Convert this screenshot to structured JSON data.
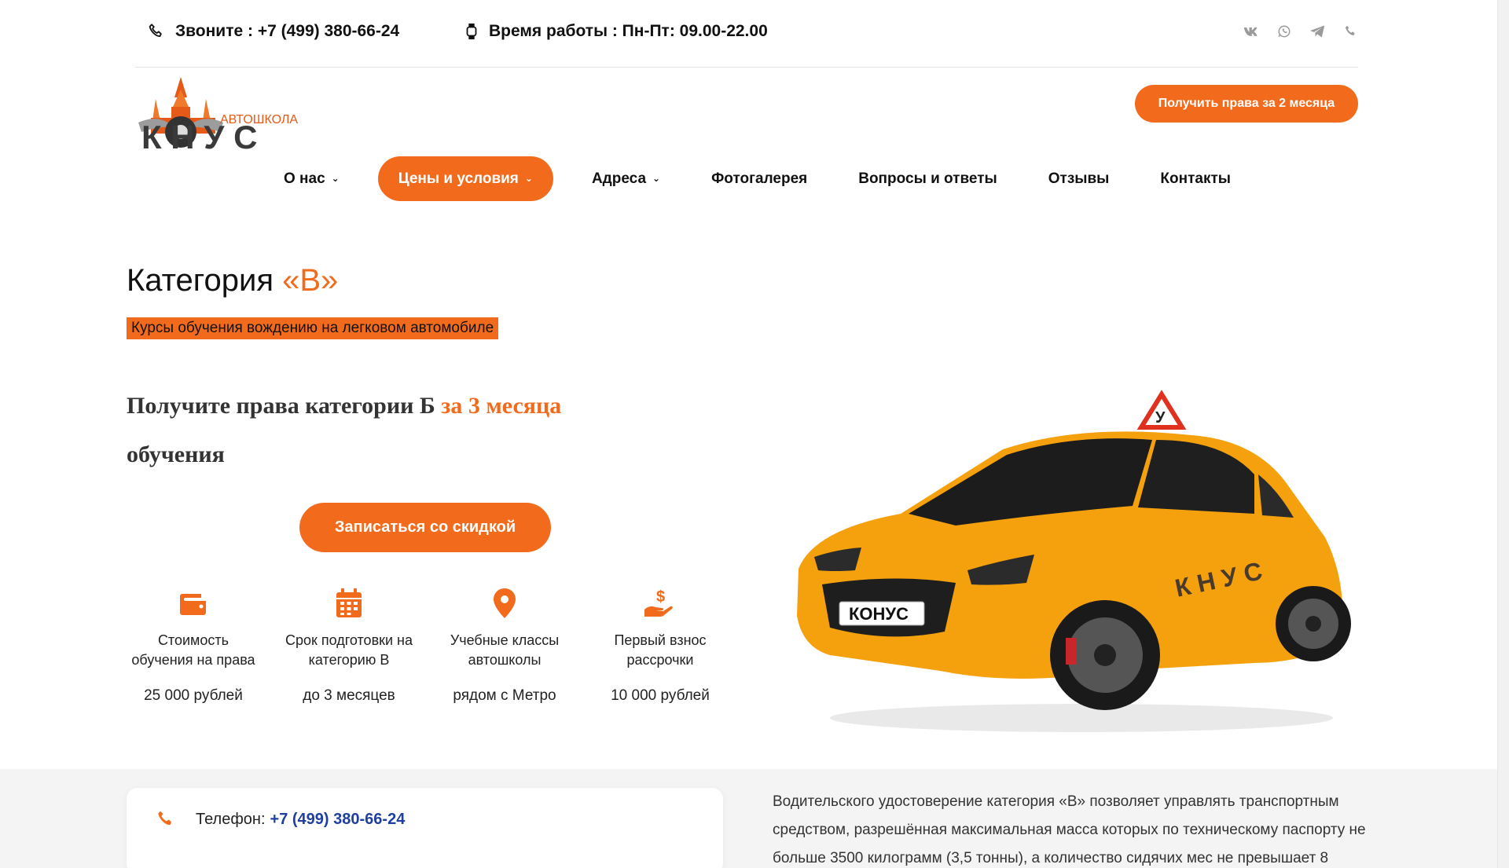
{
  "topbar": {
    "phone": "Звоните : +7 (499) 380-66-24",
    "hours": "Время работы : Пн-Пт: 09.00-22.00",
    "socials": [
      "vk-icon",
      "whatsapp-icon",
      "telegram-icon",
      "phone-icon"
    ]
  },
  "logo": {
    "top": "АВТОШКОЛА",
    "main": "К  Н У С"
  },
  "header": {
    "cta": "Получить права за 2 месяца"
  },
  "nav": {
    "items": [
      {
        "label": "О нас",
        "dropdown": true
      },
      {
        "label": "Цены и условия",
        "dropdown": true,
        "active": true
      },
      {
        "label": "Адреса",
        "dropdown": true
      },
      {
        "label": "Фотогалерея"
      },
      {
        "label": "Вопросы и ответы"
      },
      {
        "label": "Отзывы"
      },
      {
        "label": "Контакты"
      }
    ]
  },
  "hero": {
    "title": "Категория",
    "title_accent": "«В»",
    "subtitle": "Курсы обучения вождению на легковом автомобиле",
    "lead": "Получите права категории Б",
    "lead_accent": "за 3 месяца",
    "lead_end": "обучения",
    "cta": "Записаться со скидкой"
  },
  "features": [
    {
      "icon": "wallet-icon",
      "label": "Стоимость обучения на права",
      "value": "25 000 рублей"
    },
    {
      "icon": "calendar-icon",
      "label": "Срок подготовки на категорию В",
      "value": "до 3 месяцев"
    },
    {
      "icon": "map-pin-icon",
      "label": "Учебные классы автошколы",
      "value": "рядом с Метро"
    },
    {
      "icon": "hand-money-icon",
      "label": "Первый взнос рассрочки",
      "value": "10 000 рублей"
    }
  ],
  "car": {
    "plate": "КОНУС",
    "sign": "У",
    "door_text": "К  Н У С"
  },
  "contact": {
    "label": "Телефон:",
    "phone": "+7 (499) 380-66-24"
  },
  "description": "Водительского удостоверение категория «В» позволяет управлять транспортным средством, разрешённая максимальная масса которых по техническому паспорту не больше 3500 килограмм (3,5 тонны), а количество сидячих мес не превышает 8",
  "colors": {
    "accent": "#f26b1d",
    "link": "#1f3fa0"
  }
}
